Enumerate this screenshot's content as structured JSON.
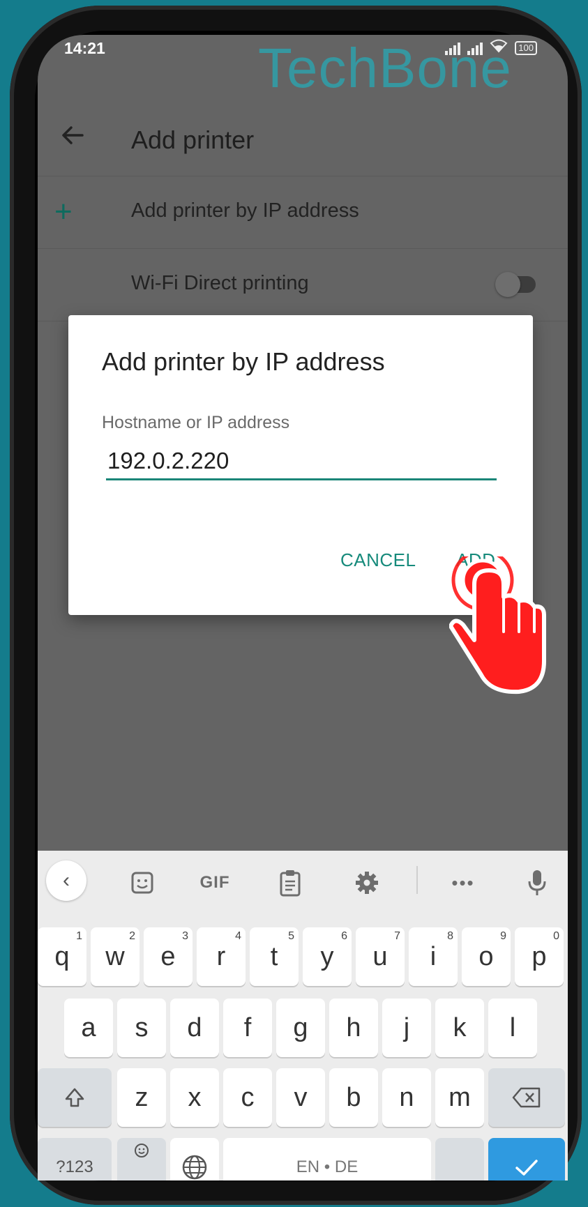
{
  "status_bar": {
    "time": "14:21",
    "battery": "100"
  },
  "watermark": "TechBone",
  "app_bar": {
    "title": "Add printer"
  },
  "list": {
    "add_by_ip_label": "Add printer by IP address",
    "wifi_direct_label": "Wi-Fi Direct printing",
    "wifi_direct_enabled": false
  },
  "dialog": {
    "title": "Add printer by IP address",
    "field_label": "Hostname or IP address",
    "field_value": "192.0.2.220",
    "cancel_label": "CANCEL",
    "add_label": "ADD"
  },
  "keyboard": {
    "toolbar": {
      "gif_label": "GIF"
    },
    "row1": [
      {
        "k": "q",
        "s": "1"
      },
      {
        "k": "w",
        "s": "2"
      },
      {
        "k": "e",
        "s": "3"
      },
      {
        "k": "r",
        "s": "4"
      },
      {
        "k": "t",
        "s": "5"
      },
      {
        "k": "y",
        "s": "6"
      },
      {
        "k": "u",
        "s": "7"
      },
      {
        "k": "i",
        "s": "8"
      },
      {
        "k": "o",
        "s": "9"
      },
      {
        "k": "p",
        "s": "0"
      }
    ],
    "row2": [
      "a",
      "s",
      "d",
      "f",
      "g",
      "h",
      "j",
      "k",
      "l"
    ],
    "row3": [
      "z",
      "x",
      "c",
      "v",
      "b",
      "n",
      "m"
    ],
    "numbers_label": "?123",
    "space_label": "EN • DE"
  }
}
